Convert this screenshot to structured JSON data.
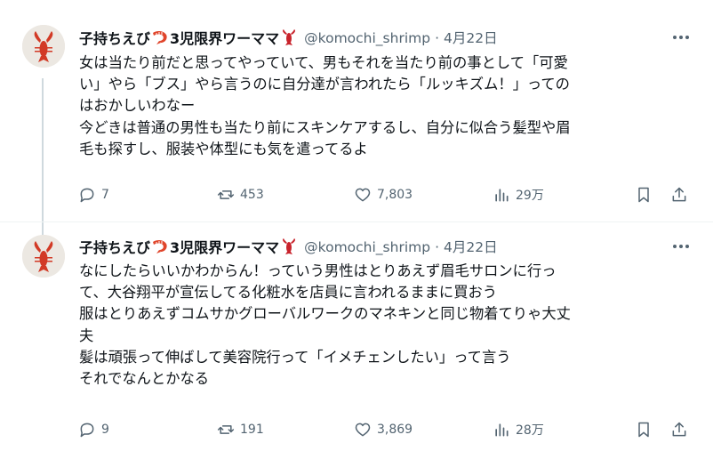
{
  "tweets": [
    {
      "display_name": "子持ちえび",
      "name_suffix": "3児限界ワーママ",
      "handle": "@komochi_shrimp",
      "separator": "·",
      "date": "4月22日",
      "lines": [
        "女は当たり前だと思ってやっていて、男もそれを当たり前の事として「可愛",
        "い」やら「ブス」やら言うのに自分達が言われたら「ルッキズム！」っての",
        "はおかしいわなー",
        "今どきは普通の男性も当たり前にスキンケアするし、自分に似合う髪型や眉",
        "毛も探すし、服装や体型にも気を遣ってるよ"
      ],
      "replies": "7",
      "reposts": "453",
      "likes": "7,803",
      "views": "29万"
    },
    {
      "display_name": "子持ちえび",
      "name_suffix": "3児限界ワーママ",
      "handle": "@komochi_shrimp",
      "separator": "·",
      "date": "4月22日",
      "lines": [
        "なにしたらいいかわからん！っていう男性はとりあえず眉毛サロンに行っ",
        "て、大谷翔平が宣伝してる化粧水を店員に言われるままに買おう",
        "服はとりあえずコムサかグローバルワークのマネキンと同じ物着てりゃ大丈",
        "夫",
        "髪は頑張って伸ばして美容院行って「イメチェンしたい」って言う",
        "それでなんとかなる"
      ],
      "replies": "9",
      "reposts": "191",
      "likes": "3,869",
      "views": "28万"
    }
  ],
  "colors": {
    "text": "#0f1419",
    "secondary": "#536471",
    "thread_line": "#cfd9de",
    "shrimp": "#e0452b",
    "lobster": "#c8232c"
  },
  "icons": {
    "shrimp": "shrimp-emoji-icon",
    "lobster": "lobster-emoji-icon",
    "more": "more-dots-icon",
    "reply": "reply-icon",
    "repost": "repost-icon",
    "like": "like-icon",
    "views": "views-icon",
    "bookmark": "bookmark-icon",
    "share": "share-icon"
  }
}
